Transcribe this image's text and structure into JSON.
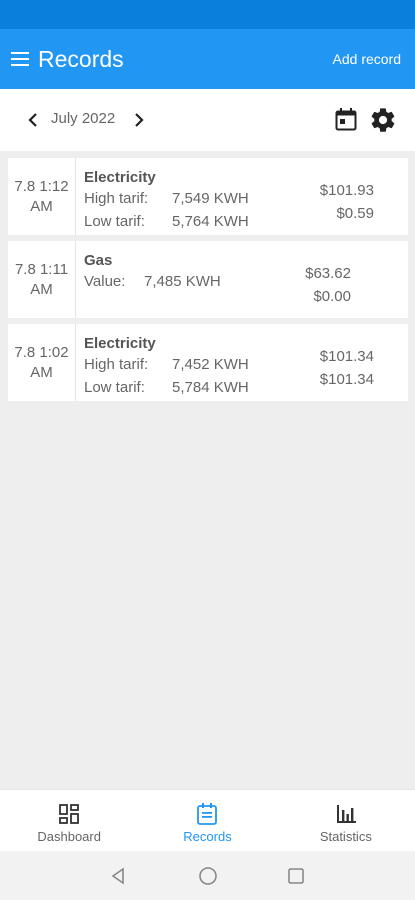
{
  "app_bar": {
    "title": "Records",
    "add_record_label": "Add record"
  },
  "toolbar": {
    "month": "July 2022"
  },
  "records": [
    {
      "date": "7.8 1:12",
      "time_suffix": "AM",
      "type": "Electricity",
      "lines": [
        {
          "label": "High tarif:",
          "value": "7,549 KWH"
        },
        {
          "label": "Low tarif:",
          "value": "5,764 KWH"
        }
      ],
      "prices": [
        "$101.93",
        "$0.59"
      ]
    },
    {
      "date": "7.8 1:11",
      "time_suffix": "AM",
      "type": "Gas",
      "lines": [
        {
          "label": "Value:",
          "value": "7,485 KWH"
        }
      ],
      "prices": [
        "$63.62",
        "$0.00"
      ]
    },
    {
      "date": "7.8 1:02",
      "time_suffix": "AM",
      "type": "Electricity",
      "lines": [
        {
          "label": "High tarif:",
          "value": "7,452 KWH"
        },
        {
          "label": "Low tarif:",
          "value": "5,784 KWH"
        }
      ],
      "prices": [
        "$101.34",
        "$101.34"
      ]
    }
  ],
  "bottom_nav": [
    {
      "label": "Dashboard",
      "icon": "dashboard-icon",
      "active": false
    },
    {
      "label": "Records",
      "icon": "records-icon",
      "active": true
    },
    {
      "label": "Statistics",
      "icon": "statistics-icon",
      "active": false
    }
  ],
  "colors": {
    "primary": "#2196f3",
    "status_bar": "#0a7fdc",
    "background": "#eeeeee"
  }
}
